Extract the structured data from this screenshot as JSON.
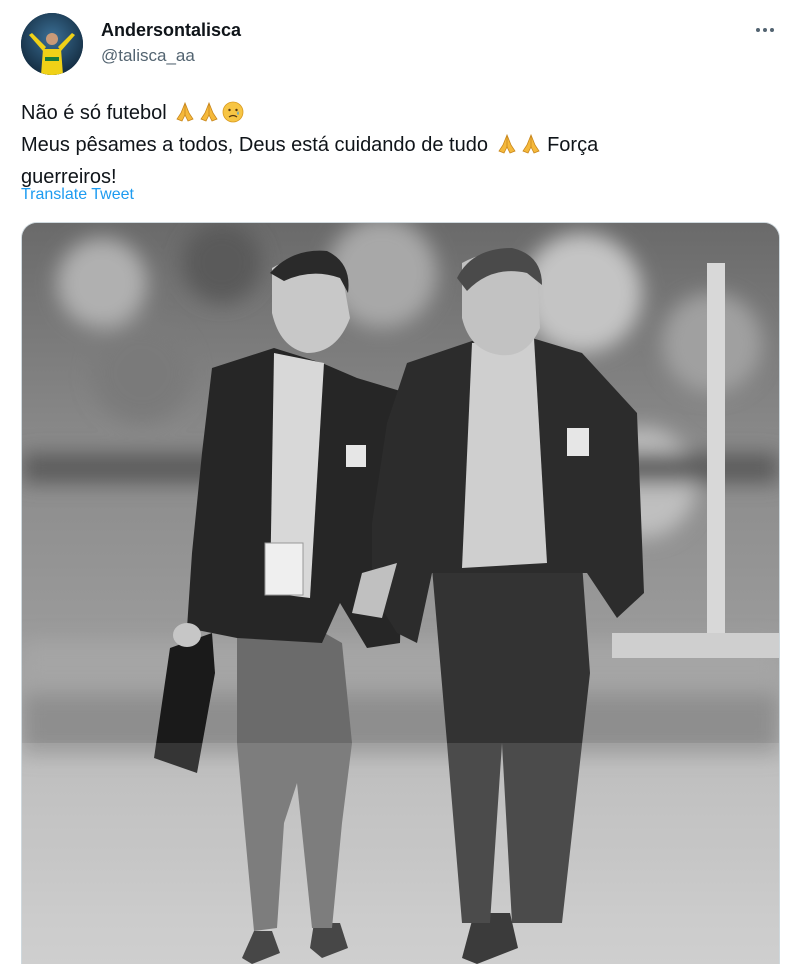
{
  "author": {
    "display_name": "Andersontalisca",
    "handle": "@talisca_aa"
  },
  "tweet": {
    "line1": "Não é só futebol",
    "line2": "Meus pêsames a todos, Deus está cuidando de tudo",
    "line2_tail": "Força",
    "line3": "guerreiros!",
    "line1_emojis": [
      "praying-hands",
      "praying-hands",
      "sad-relieved-face"
    ],
    "line2_emojis": [
      "praying-hands",
      "praying-hands"
    ]
  },
  "translate_label": "Translate Tweet",
  "colors": {
    "link": "#1d9bf0",
    "text": "#0f1419",
    "secondary": "#536471",
    "emoji_hands": "#f5b93b"
  },
  "icons": {
    "more": "more-horizontal-icon"
  }
}
